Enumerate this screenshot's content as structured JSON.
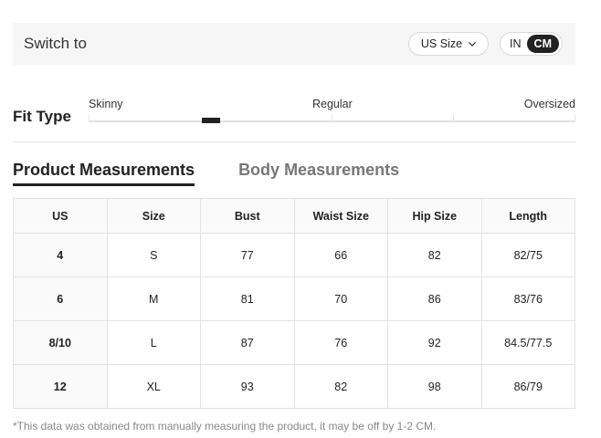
{
  "switch_bar": {
    "label": "Switch to",
    "size_select": "US Size",
    "units": [
      "IN",
      "CM"
    ],
    "active_unit": "CM"
  },
  "fit_type": {
    "title": "Fit Type",
    "labels": [
      "Skinny",
      "Regular",
      "Oversized"
    ],
    "position_fraction": 0.25
  },
  "tabs": [
    {
      "label": "Product Measurements",
      "active": true
    },
    {
      "label": "Body Measurements",
      "active": false
    }
  ],
  "table": {
    "headers": [
      "US",
      "Size",
      "Bust",
      "Waist Size",
      "Hip Size",
      "Length"
    ],
    "rows": [
      [
        "4",
        "S",
        "77",
        "66",
        "82",
        "82/75"
      ],
      [
        "6",
        "M",
        "81",
        "70",
        "86",
        "83/76"
      ],
      [
        "8/10",
        "L",
        "87",
        "76",
        "92",
        "84.5/77.5"
      ],
      [
        "12",
        "XL",
        "93",
        "82",
        "98",
        "86/79"
      ]
    ]
  },
  "footnote": "*This data was obtained from manually measuring the product, it may be off by 1-2 CM."
}
